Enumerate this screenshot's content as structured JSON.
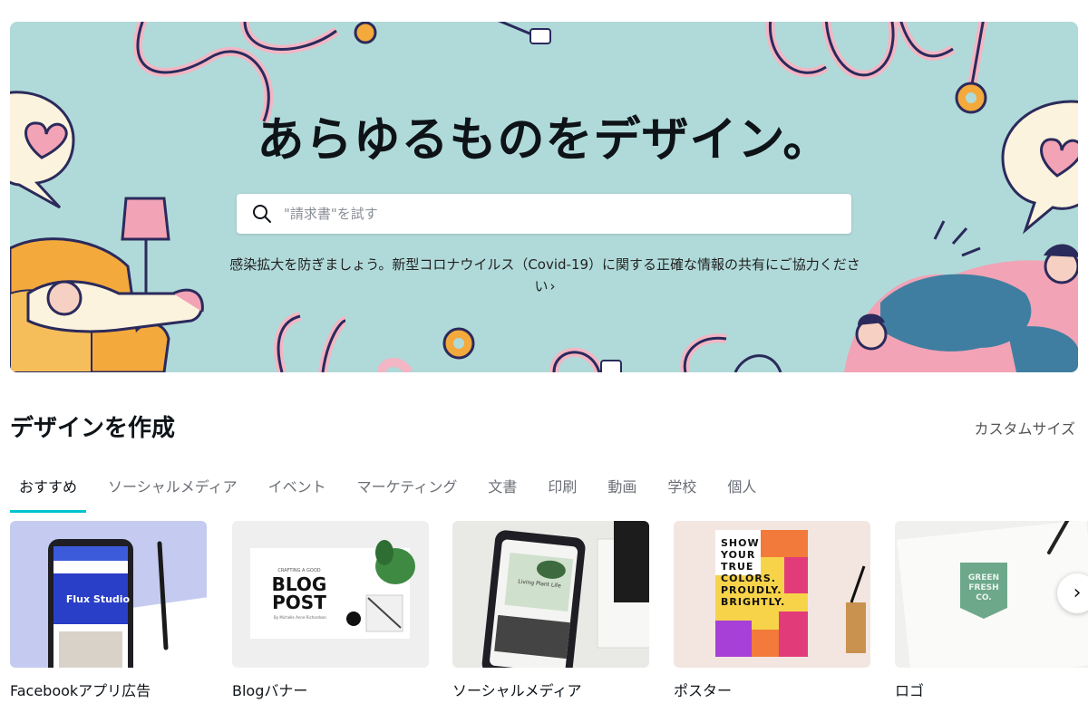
{
  "hero": {
    "title": "あらゆるものをデザイン。",
    "search_placeholder": "\"請求書\"を試す",
    "notice": "感染拡大を防ぎましょう。新型コロナウイルス（Covid-19）に関する正確な情報の共有にご協力ください",
    "notice_chevron": "›",
    "background": "#b0dad9"
  },
  "create": {
    "title": "デザインを作成",
    "custom_size": "カスタムサイズ"
  },
  "tabs": [
    {
      "label": "おすすめ",
      "active": true
    },
    {
      "label": "ソーシャルメディア"
    },
    {
      "label": "イベント"
    },
    {
      "label": "マーケティング"
    },
    {
      "label": "文書"
    },
    {
      "label": "印刷"
    },
    {
      "label": "動画"
    },
    {
      "label": "学校"
    },
    {
      "label": "個人"
    }
  ],
  "cards": [
    {
      "label": "Facebookアプリ広告",
      "phone_text": "Flux Studio"
    },
    {
      "label": "Blogバナー",
      "banner_kicker": "CRAFTING A GOOD",
      "banner_title_1": "BLOG",
      "banner_title_2": "POST",
      "banner_byline": "By Michelle Anne Richardson"
    },
    {
      "label": "ソーシャルメディア",
      "post_text_1": "Living Plant Life"
    },
    {
      "label": "ポスター",
      "poster_lines": [
        "SHOW",
        "YOUR",
        "TRUE",
        "COLORS.",
        "PROUDLY.",
        "BRIGHTLY."
      ]
    },
    {
      "label": "ロゴ",
      "logo_line_1": "GREEN",
      "logo_line_2": "FRESH CO."
    }
  ],
  "next_icon": "›",
  "accent_color": "#00c4cc"
}
